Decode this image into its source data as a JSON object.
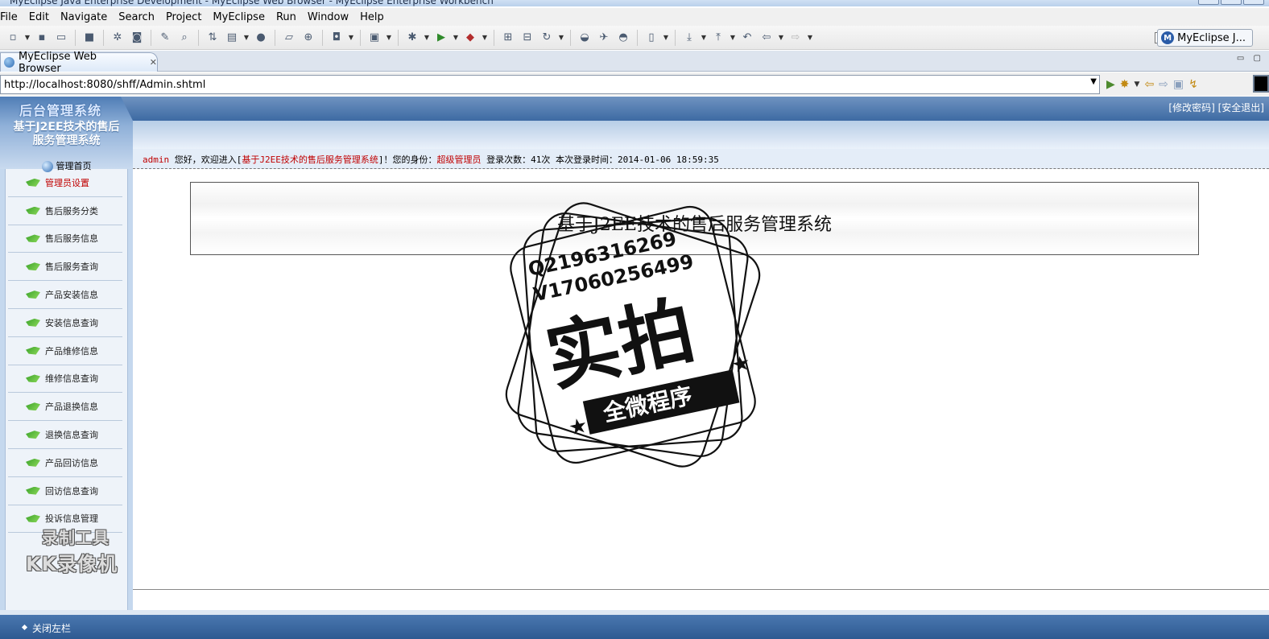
{
  "window": {
    "title": "MyEclipse Java Enterprise Development - MyEclipse Web Browser - MyEclipse Enterprise Workbench"
  },
  "menubar": [
    "File",
    "Edit",
    "Navigate",
    "Search",
    "Project",
    "MyEclipse",
    "Run",
    "Window",
    "Help"
  ],
  "toolbar": {
    "perspective_label": "MyEclipse J..."
  },
  "editor_tab": {
    "label": "MyEclipse Web Browser",
    "close_glyph": "✕"
  },
  "browser": {
    "url": "http://localhost:8080/shff/Admin.shtml"
  },
  "page": {
    "logo_title": "后台管理系统",
    "system_name_line1": "基于J2EE技术的售后",
    "system_name_line2": "服务管理系统",
    "top_links": {
      "change_password": "[修改密码]",
      "logout": "[安全退出]"
    },
    "welcome": {
      "user": "admin",
      "greeting": " 您好，欢迎进入[",
      "system_link": "基于J2EE技术的售后服务管理系统",
      "after_link": "]！您的身份：",
      "role": "超级管理员",
      "stats": " 登录次数：41次 本次登录时间：2014-01-06 18:59:35"
    },
    "home_link": "管理首页",
    "sidebar_items": [
      "管理员设置",
      "售后服务分类",
      "售后服务信息",
      "售后服务查询",
      "产品安装信息",
      "安装信息查询",
      "产品维修信息",
      "维修信息查询",
      "产品退换信息",
      "退换信息查询",
      "产品回访信息",
      "回访信息查询",
      "投诉信息管理"
    ],
    "banner_title": "基于J2EE技术的售后服务管理系统",
    "footer_toggle": "关闭左栏"
  },
  "watermark": {
    "stamp_line1": "Q2196316269",
    "stamp_line2": "V17060256499",
    "stamp_big": "实拍",
    "stamp_ribbon": "全微程序",
    "recorder_line1": "录制工具",
    "recorder_line2": "KK录像机"
  }
}
